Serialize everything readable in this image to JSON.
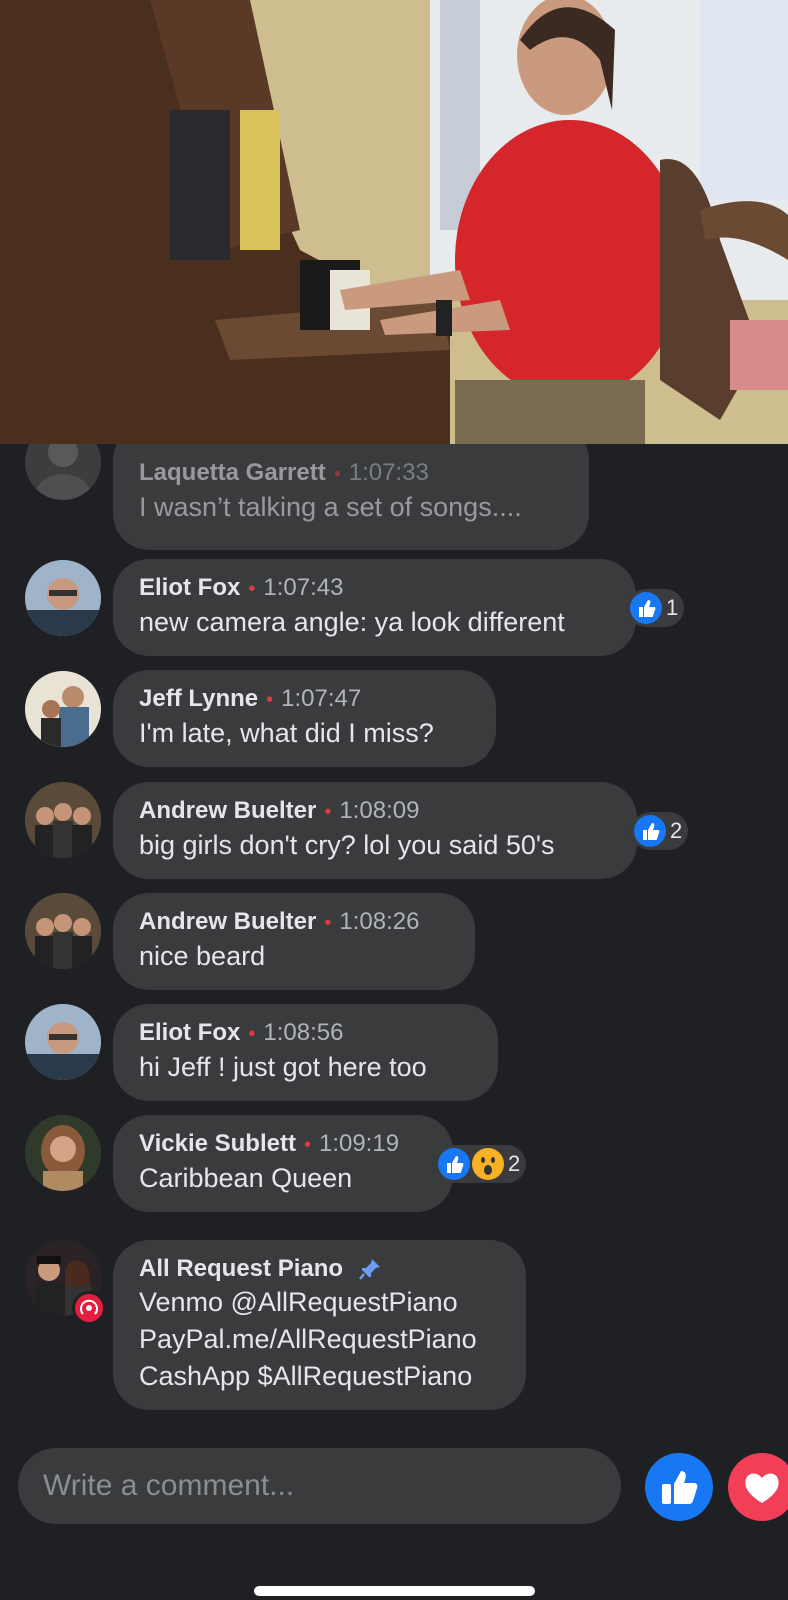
{
  "video": {
    "description_icon": "live-video"
  },
  "comments": [
    {
      "name": "Laquetta Garrett",
      "time": "1:07:33",
      "text": "I wasn’t talking a set of songs...."
    },
    {
      "name": "Eliot Fox",
      "time": "1:07:43",
      "text": "new camera angle: ya look different",
      "reaction_count": "1"
    },
    {
      "name": "Jeff Lynne",
      "time": "1:07:47",
      "text": "I'm late, what did I miss?"
    },
    {
      "name": "Andrew Buelter",
      "time": "1:08:09",
      "text": " big girls don't cry? lol you said 50's",
      "reaction_count": "2"
    },
    {
      "name": "Andrew Buelter",
      "time": "1:08:26",
      "text": "nice beard"
    },
    {
      "name": "Eliot Fox",
      "time": "1:08:56",
      "text": "hi Jeff ! just got here too"
    },
    {
      "name": "Vickie Sublett",
      "time": "1:09:19",
      "text": "Caribbean Queen",
      "reaction_count": "2"
    }
  ],
  "pinned": {
    "name": "All Request Piano",
    "lines": [
      "Venmo @AllRequestPiano",
      "PayPal.me/AllRequestPiano",
      "CashApp $AllRequestPiano"
    ]
  },
  "composer": {
    "placeholder": "Write a comment..."
  },
  "colors": {
    "accent": "#1877f2",
    "love": "#f33e58",
    "dot": "#e0393e",
    "bubble": "#3a3b3c",
    "background": "#1f2024"
  }
}
